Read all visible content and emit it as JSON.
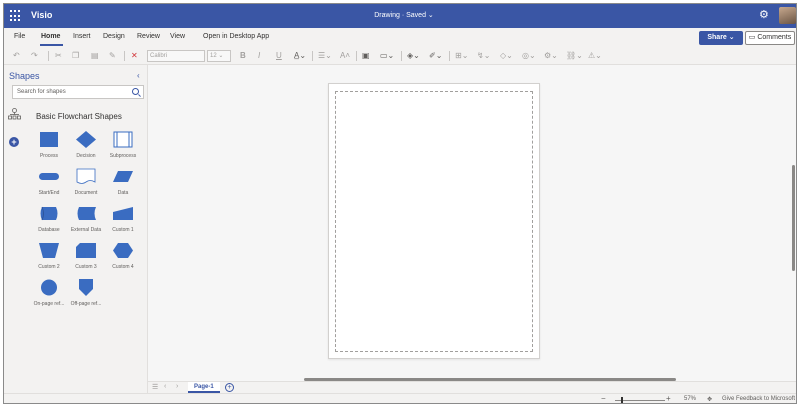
{
  "app": {
    "name": "Visio",
    "document_title": "Drawing  ·  Saved ⌄"
  },
  "menu": {
    "tabs": [
      "File",
      "Home",
      "Insert",
      "Design",
      "Review",
      "View"
    ],
    "active_tab": "Home",
    "open_desktop": "Open in Desktop App",
    "share": "Share",
    "comments": "Comments"
  },
  "toolbar": {
    "font_family": "Calibri",
    "font_size": "12",
    "bold": "B",
    "italic": "I",
    "underline": "U"
  },
  "shapes_panel": {
    "title": "Shapes",
    "search_placeholder": "Search for shapes",
    "stencil_title": "Basic Flowchart Shapes",
    "shapes": [
      {
        "label": "Process",
        "icon": "process-shape"
      },
      {
        "label": "Decision",
        "icon": "decision-shape"
      },
      {
        "label": "Subprocess",
        "icon": "subprocess-shape"
      },
      {
        "label": "Start/End",
        "icon": "start-end-shape"
      },
      {
        "label": "Document",
        "icon": "document-shape"
      },
      {
        "label": "Data",
        "icon": "data-shape"
      },
      {
        "label": "Database",
        "icon": "database-shape"
      },
      {
        "label": "External Data",
        "icon": "external-data-shape"
      },
      {
        "label": "Custom 1",
        "icon": "custom-1-shape"
      },
      {
        "label": "Custom 2",
        "icon": "custom-2-shape"
      },
      {
        "label": "Custom 3",
        "icon": "custom-3-shape"
      },
      {
        "label": "Custom 4",
        "icon": "custom-4-shape"
      },
      {
        "label": "On-page ref...",
        "icon": "on-page-reference-shape"
      },
      {
        "label": "Off-page ref...",
        "icon": "off-page-reference-shape"
      }
    ]
  },
  "pages": {
    "tabs": [
      "Page-1"
    ]
  },
  "status": {
    "zoom": "57%",
    "feedback": "Give Feedback to Microsoft"
  },
  "colors": {
    "brand": "#3a56a5",
    "shape_fill": "#3a6cc1"
  }
}
